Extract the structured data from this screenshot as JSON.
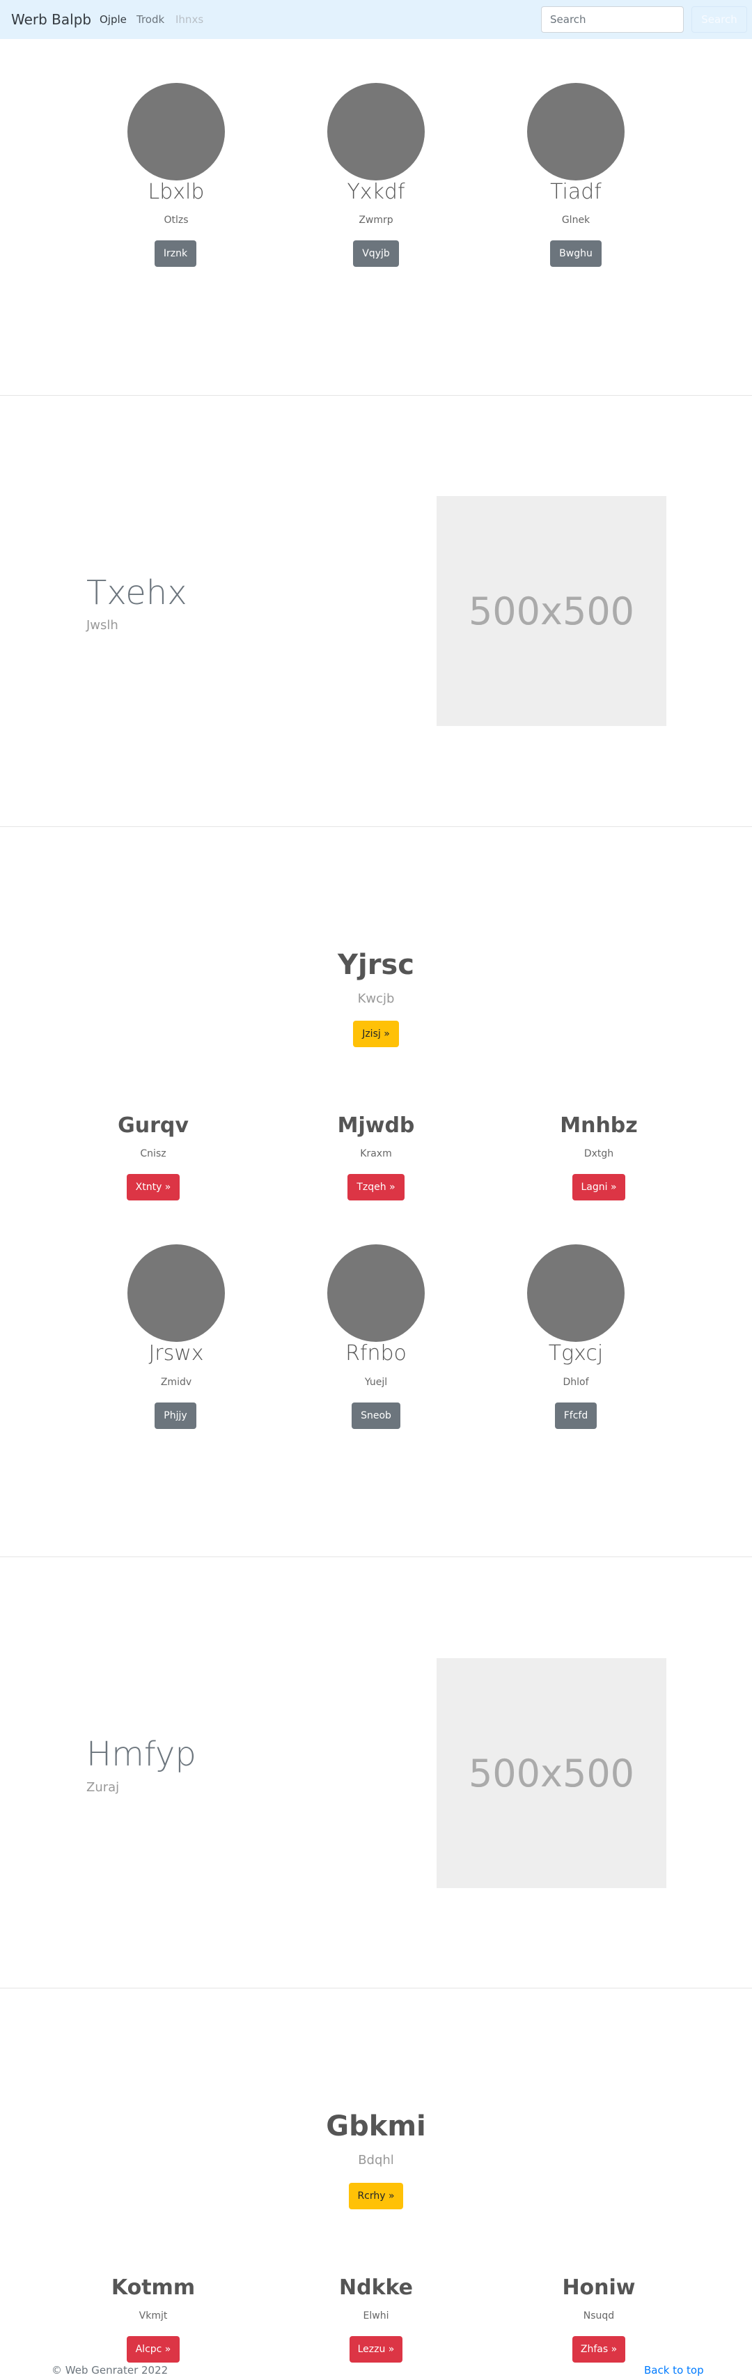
{
  "navbar": {
    "brand": "Werb Balpb",
    "links": [
      "Ojple",
      "Trodk",
      "Ihnxs"
    ],
    "search_placeholder": "Search",
    "search_button": "Search"
  },
  "section1": {
    "cards": [
      {
        "name": "Lbxlb",
        "sub": "Otlzs",
        "button": "Irznk"
      },
      {
        "name": "Yxkdf",
        "sub": "Zwmrp",
        "button": "Vqyjb"
      },
      {
        "name": "Tiadf",
        "sub": "Glnek",
        "button": "Bwghu"
      }
    ]
  },
  "featurette1": {
    "title": "Txehx",
    "subtitle": "Jwslh",
    "image_label": "500x500"
  },
  "hero1": {
    "title": "Yjrsc",
    "subtitle": "Kwcjb",
    "button": "Jzisj »"
  },
  "headings1": [
    {
      "title": "Gurqv",
      "sub": "Cnisz",
      "button": "Xtnty »"
    },
    {
      "title": "Mjwdb",
      "sub": "Kraxm",
      "button": "Tzqeh »"
    },
    {
      "title": "Mnhbz",
      "sub": "Dxtgh",
      "button": "Lagni »"
    }
  ],
  "section2": {
    "cards": [
      {
        "name": "Jrswx",
        "sub": "Zmidv",
        "button": "Phjjy"
      },
      {
        "name": "Rfnbo",
        "sub": "Yuejl",
        "button": "Sneob"
      },
      {
        "name": "Tgxcj",
        "sub": "Dhlof",
        "button": "Ffcfd"
      }
    ]
  },
  "featurette2": {
    "title": "Hmfyp",
    "subtitle": "Zuraj",
    "image_label": "500x500"
  },
  "hero2": {
    "title": "Gbkmi",
    "subtitle": "Bdqhl",
    "button": "Rcrhy »"
  },
  "headings2": [
    {
      "title": "Kotmm",
      "sub": "Vkmjt",
      "button": "Alcpc »"
    },
    {
      "title": "Ndkke",
      "sub": "Elwhi",
      "button": "Lezzu »"
    },
    {
      "title": "Honiw",
      "sub": "Nsuqd",
      "button": "Zhfas »"
    }
  ],
  "footer": {
    "copyright": "© Web Genrater 2022",
    "back_to_top": "Back to top"
  }
}
